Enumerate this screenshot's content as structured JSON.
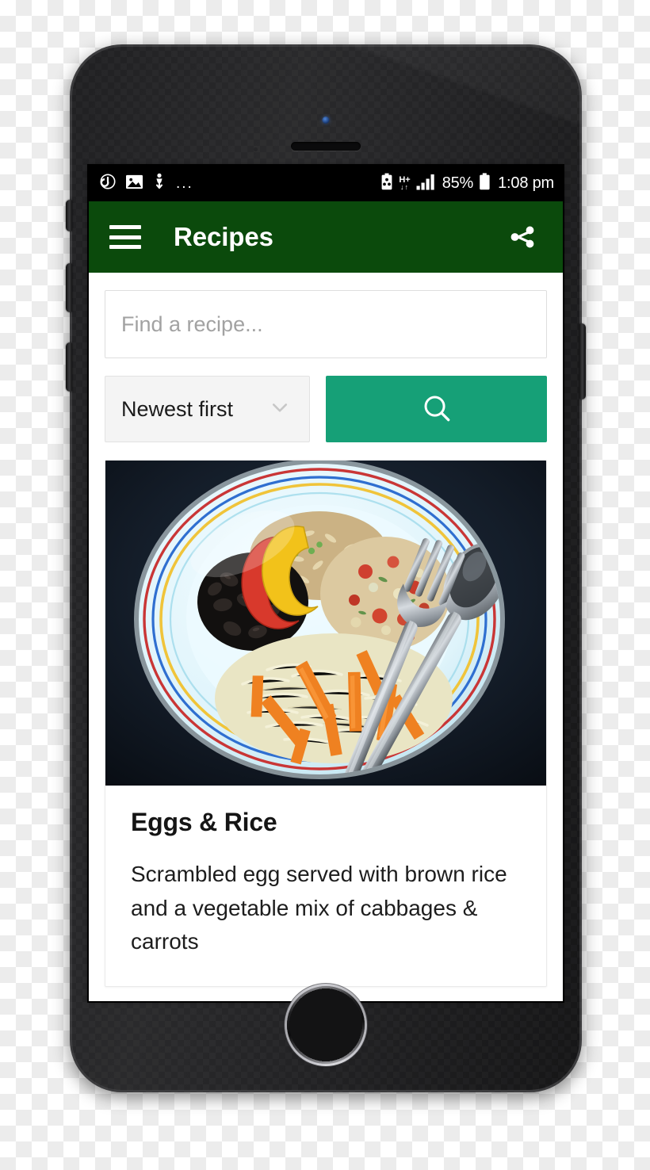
{
  "status_bar": {
    "left_icons": [
      "alarm-timer-icon",
      "image-icon",
      "download-icon"
    ],
    "more_indicator": "...",
    "right_icons": [
      "battery-saver-icon",
      "signal-bars-icon",
      "battery-icon"
    ],
    "data_network": "H+",
    "battery_percent": "85%",
    "time": "1:08 pm"
  },
  "app_bar": {
    "menu_icon": "hamburger-menu-icon",
    "title": "Recipes",
    "share_icon": "share-icon",
    "background_color": "#0b4a0c"
  },
  "search": {
    "placeholder": "Find a recipe...",
    "value": "",
    "sort_selected": "Newest first",
    "sort_chevron_icon": "chevron-down-icon",
    "submit_icon": "search-icon",
    "submit_color": "#16a077"
  },
  "recipes": [
    {
      "title": "Eggs & Rice",
      "description": "Scrambled egg served with brown rice and a vegetable mix of cabbages & carrots",
      "photo_alt": "plate-of-rice-beans-cabbage-carrots-with-fork-and-spoon"
    }
  ],
  "device": {
    "home_button": "home-button",
    "front_camera": "front-camera",
    "earpiece": "earpiece-speaker"
  }
}
